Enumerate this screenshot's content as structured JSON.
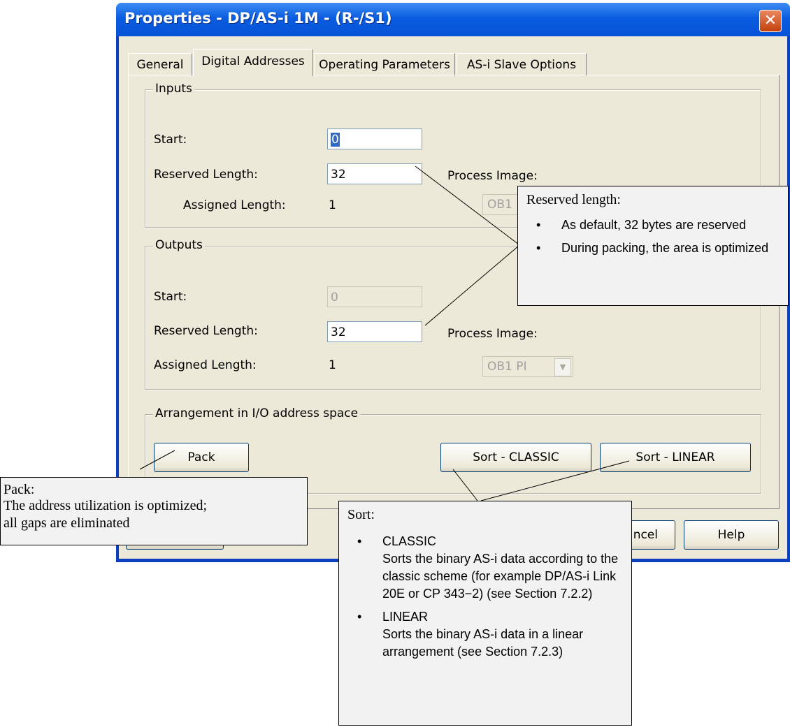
{
  "window": {
    "title": "Properties - DP/AS-i 1M - (R-/S1)",
    "close_glyph": "✕"
  },
  "tabs": [
    {
      "label": "General"
    },
    {
      "label": "Digital Addresses"
    },
    {
      "label": "Operating Parameters"
    },
    {
      "label": "AS-i Slave Options"
    }
  ],
  "active_tab": "Digital Addresses",
  "inputs": {
    "group_title": "Inputs",
    "start_label": "Start:",
    "start_value": "0",
    "reserved_label": "Reserved Length:",
    "reserved_value": "32",
    "assigned_label": "Assigned Length:",
    "assigned_value": "1",
    "process_image_label": "Process Image:",
    "process_image_value": "OB1"
  },
  "outputs": {
    "group_title": "Outputs",
    "start_label": "Start:",
    "start_value": "0",
    "reserved_label": "Reserved Length:",
    "reserved_value": "32",
    "assigned_label": "Assigned Length:",
    "assigned_value": "1",
    "process_image_label": "Process Image:",
    "process_image_value": "OB1 PI"
  },
  "arrangement": {
    "group_title": "Arrangement in I/O address space",
    "pack_label": "Pack",
    "sort_classic_label": "Sort - CLASSIC",
    "sort_linear_label": "Sort - LINEAR"
  },
  "footer": {
    "cancel_label_visible": "ncel",
    "help_label": "Help"
  },
  "callouts": {
    "reserved": {
      "head": "Reserved length:",
      "bullets": [
        "As default, 32 bytes are reserved",
        "During packing, the area is optimized"
      ]
    },
    "pack": {
      "head": "Pack:",
      "lines": [
        "The address utilization is optimized;",
        "all gaps are eliminated"
      ]
    },
    "sort": {
      "head": "Sort:",
      "bullets": [
        "CLASSIC\nSorts the binary AS-i data according to the classic scheme (for example DP/AS-i Link 20E or CP 343−2) (see Section 7.2.2)",
        "LINEAR\nSorts the binary AS-i data in a linear arrangement (see Section 7.2.3)"
      ],
      "bullet_glyph": "•"
    }
  },
  "colors": {
    "titlebar": "#0a5de0",
    "dialog_face": "#ece9d8",
    "callout_bg": "#f2f2f2",
    "close_button": "#c2400e"
  }
}
